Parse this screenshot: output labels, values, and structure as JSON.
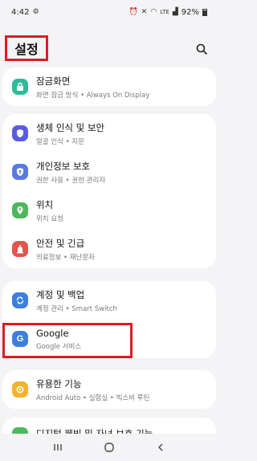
{
  "status": {
    "time": "4:42",
    "battery": "92%",
    "icons": [
      "settings-icon",
      "alarm-icon",
      "mute-icon",
      "wifi-icon",
      "lte-icon",
      "signal-icon",
      "battery-icon"
    ]
  },
  "header": {
    "title": "설정",
    "search_icon": "search-icon"
  },
  "items": [
    {
      "id": "lockscreen",
      "title": "잠금화면",
      "subtitle": "화면 잠금 방식 • Always On Display",
      "icon": "lock-icon",
      "color": "#2fbb9a"
    },
    {
      "id": "biometrics",
      "title": "생체 인식 및 보안",
      "subtitle": "얼굴 인식 • 지문",
      "icon": "shield-icon",
      "color": "#5a5ce0"
    },
    {
      "id": "privacy",
      "title": "개인정보 보호",
      "subtitle": "권한 사용 • 권한 관리자",
      "icon": "privacy-shield-icon",
      "color": "#5a7ae0"
    },
    {
      "id": "location",
      "title": "위치",
      "subtitle": "위치 요청",
      "icon": "location-pin-icon",
      "color": "#4cb85a"
    },
    {
      "id": "safety",
      "title": "안전 및 긴급",
      "subtitle": "의료정보 • 재난문자",
      "icon": "emergency-icon",
      "color": "#e2554a"
    },
    {
      "id": "accounts",
      "title": "계정 및 백업",
      "subtitle": "계정 관리 • Smart Switch",
      "icon": "sync-icon",
      "color": "#3c7fe0"
    },
    {
      "id": "google",
      "title": "Google",
      "subtitle": "Google 서비스",
      "icon": "google-icon",
      "color": "#3c7fe0"
    },
    {
      "id": "advanced",
      "title": "유용한 기능",
      "subtitle": "Android Auto • 실험실 • 빅스비 루틴",
      "icon": "gear-plus-icon",
      "color": "#f2b22a"
    },
    {
      "id": "wellbeing",
      "title": "디지털 웰빙 및 자녀 보호 기능",
      "subtitle": "",
      "icon": "wellbeing-icon",
      "color": "#4cb85a"
    }
  ],
  "nav": {
    "recent": "recent-apps-icon",
    "home": "home-icon",
    "back": "back-icon"
  }
}
